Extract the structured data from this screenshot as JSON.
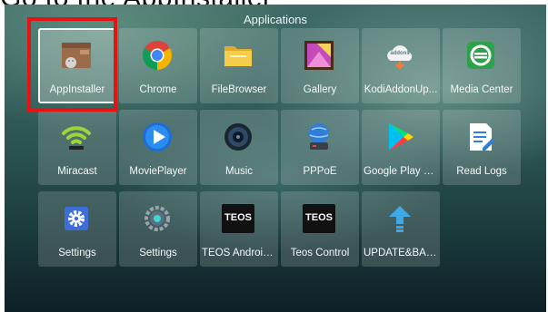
{
  "caption": "Go to the AppInstaller",
  "screen": {
    "title": "Applications"
  },
  "apps": [
    {
      "label": "AppInstaller",
      "icon": "appinstaller-icon",
      "selected": true
    },
    {
      "label": "Chrome",
      "icon": "chrome-icon"
    },
    {
      "label": "FileBrowser",
      "icon": "folder-icon"
    },
    {
      "label": "Gallery",
      "icon": "gallery-icon"
    },
    {
      "label": "KodiAddonUp...",
      "icon": "cloud-addons-icon",
      "icon_text": "addons"
    },
    {
      "label": "Media Center",
      "icon": "media-center-icon"
    },
    {
      "label": "Miracast",
      "icon": "wifi-icon"
    },
    {
      "label": "MoviePlayer",
      "icon": "play-icon"
    },
    {
      "label": "Music",
      "icon": "speaker-icon"
    },
    {
      "label": "PPPoE",
      "icon": "globe-network-icon"
    },
    {
      "label": "Google Play S...",
      "icon": "google-play-icon"
    },
    {
      "label": "Read Logs",
      "icon": "document-icon"
    },
    {
      "label": "Settings",
      "icon": "gear-icon"
    },
    {
      "label": "Settings",
      "icon": "settings-circle-icon"
    },
    {
      "label": "TEOS Android...",
      "icon": "teos-icon",
      "icon_text": "TEOS"
    },
    {
      "label": "Teos Control",
      "icon": "teos-icon",
      "icon_text": "TEOS"
    },
    {
      "label": "UPDATE&BAC...",
      "icon": "update-arrow-icon"
    }
  ],
  "colors": {
    "highlight": "#e41414",
    "chrome_blue": "#4285f4",
    "chrome_red": "#db4437",
    "chrome_yellow": "#f4b400",
    "chrome_green": "#0f9d58"
  }
}
